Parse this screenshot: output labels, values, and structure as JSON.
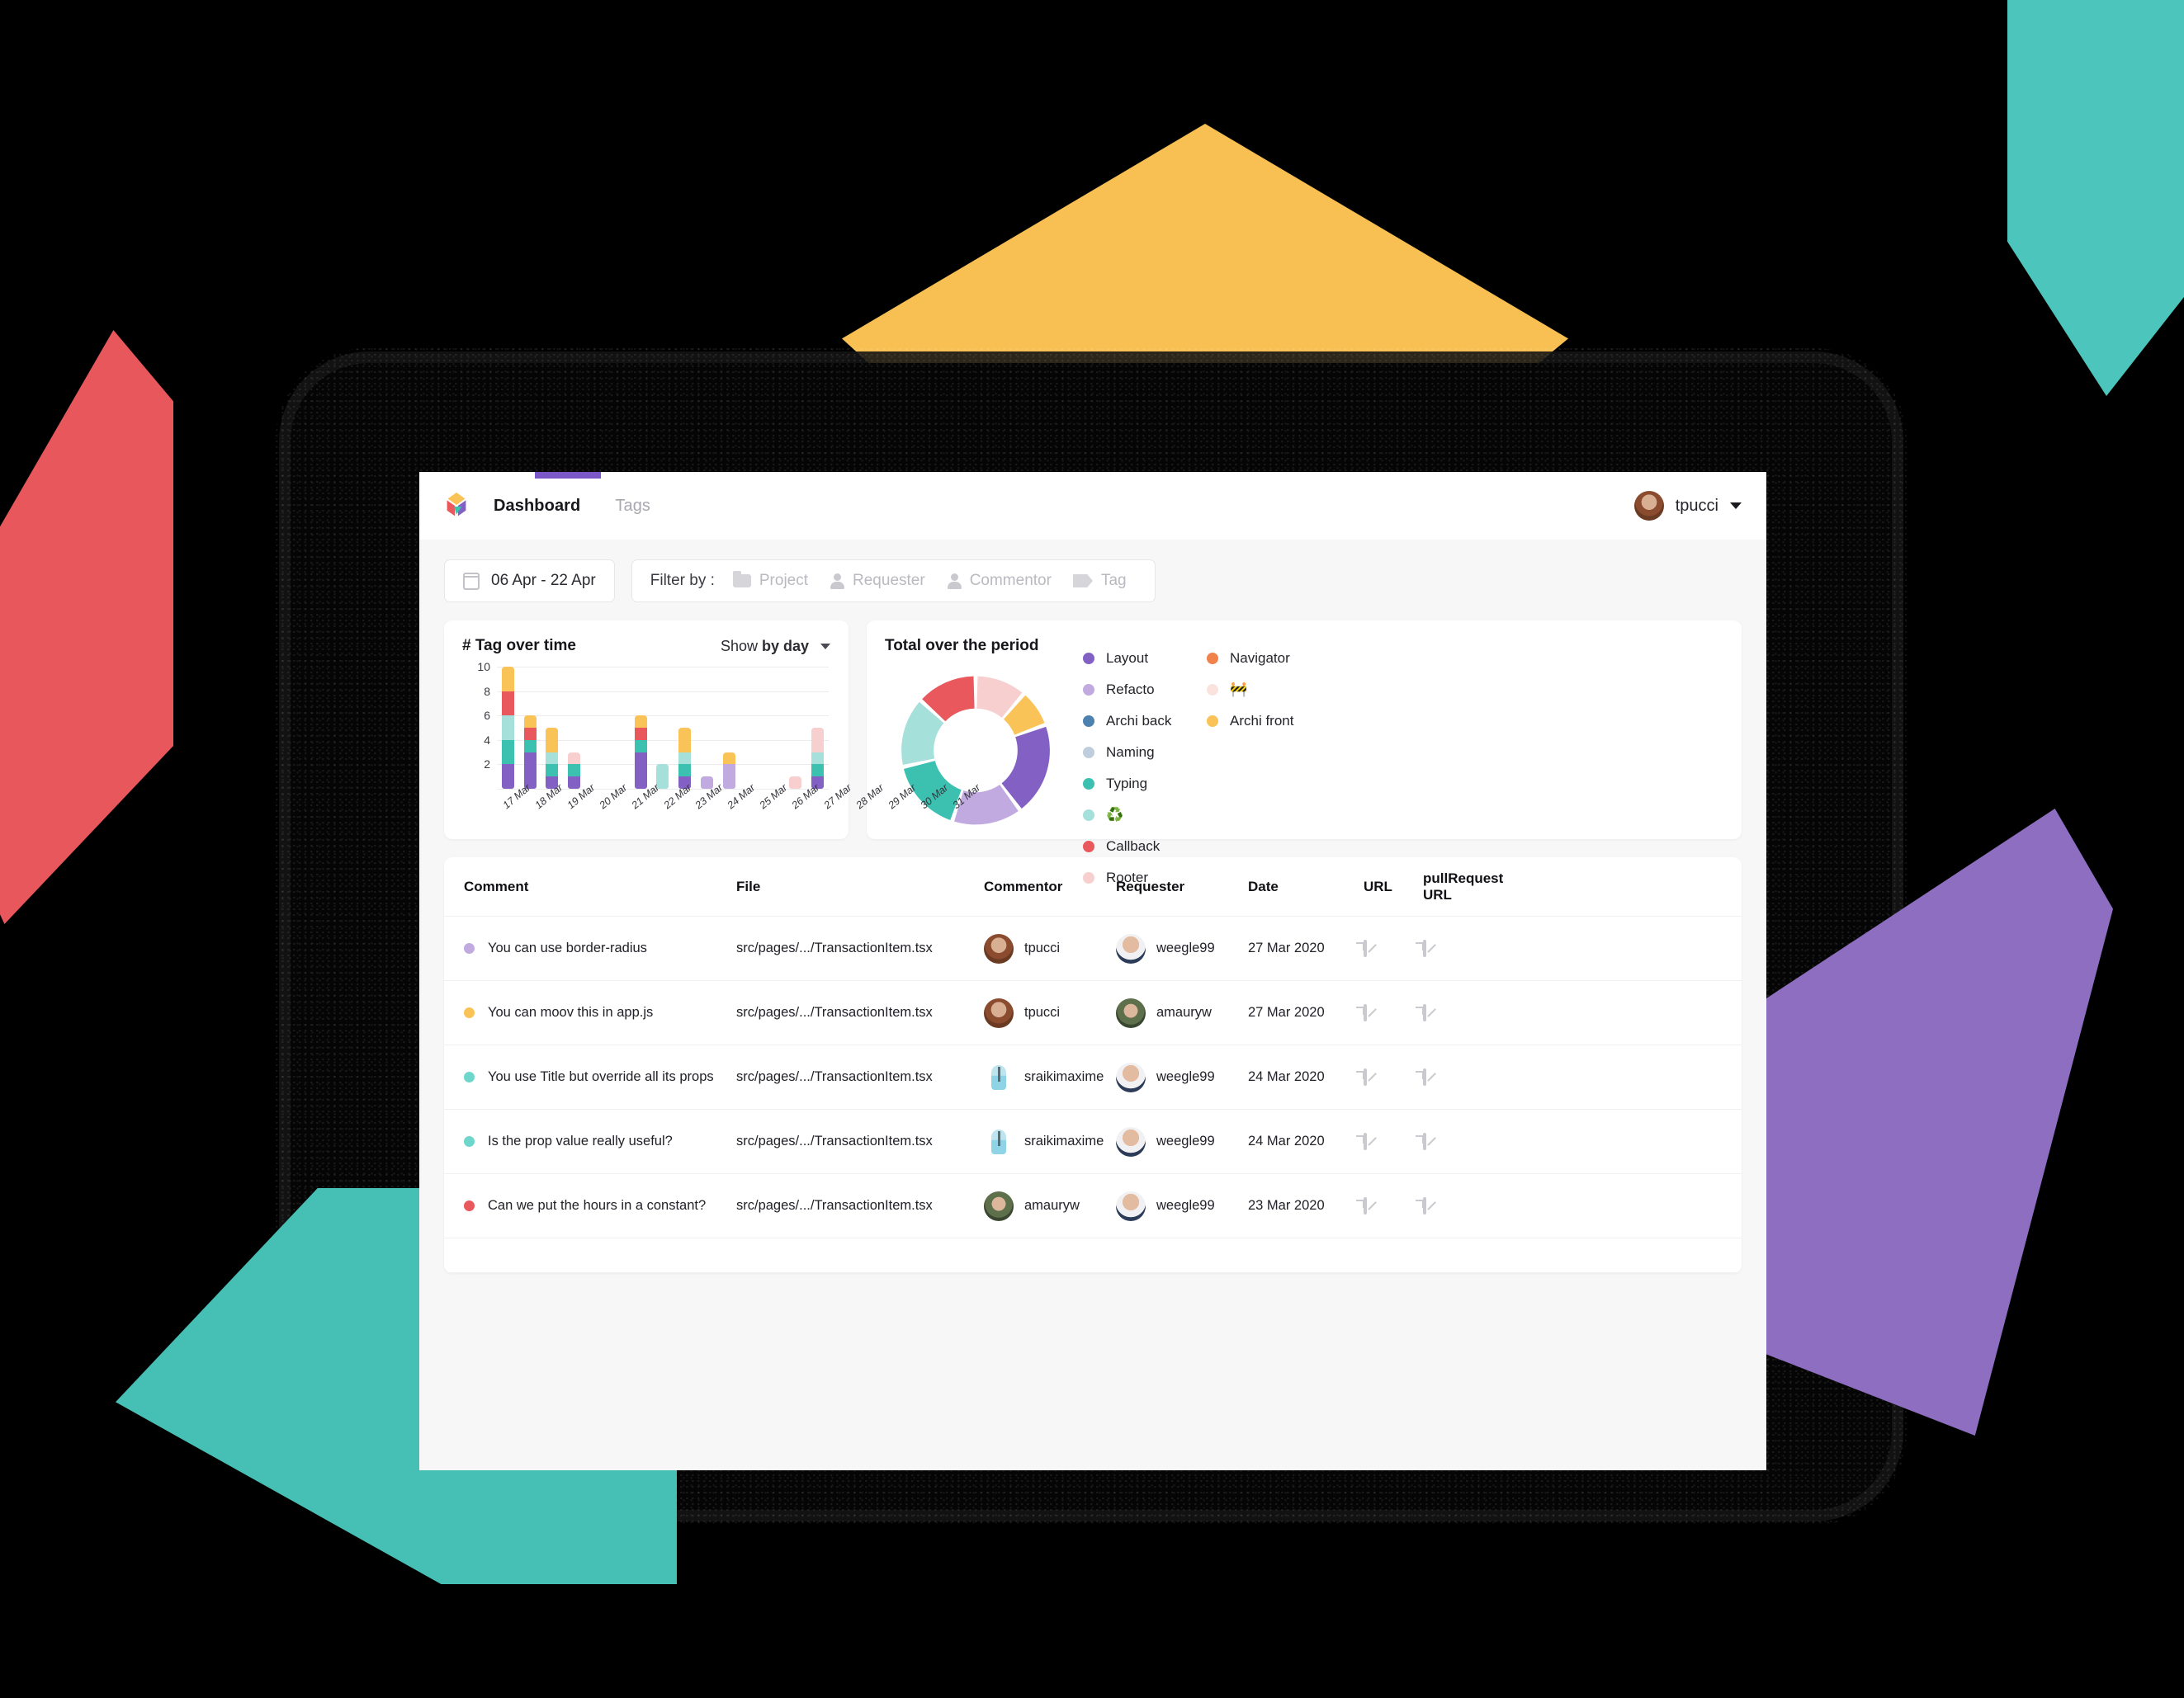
{
  "app": {
    "logo_name": "cube-logo",
    "nav": [
      {
        "label": "Dashboard",
        "active": true
      },
      {
        "label": "Tags",
        "active": false
      }
    ],
    "user": {
      "name": "tpucci",
      "avatar": "avatar-tpucci"
    }
  },
  "filters": {
    "date_range": "06 Apr - 22 Apr",
    "filter_by_label": "Filter by :",
    "chips": [
      {
        "label": "Project",
        "icon": "folder-icon"
      },
      {
        "label": "Requester",
        "icon": "person-icon"
      },
      {
        "label": "Commentor",
        "icon": "person-icon"
      },
      {
        "label": "Tag",
        "icon": "tag-icon"
      }
    ]
  },
  "bar_card": {
    "title": "# Tag over time",
    "show_by_prefix": "Show ",
    "show_by_value": "by day"
  },
  "donut_card": {
    "title": "Total over the period"
  },
  "legend": [
    {
      "label": "Layout",
      "color": "#8360C3"
    },
    {
      "label": "Navigator",
      "color": "#F0824C"
    },
    {
      "label": "Refacto",
      "color": "#C0AADF"
    },
    {
      "label": "🚧",
      "color": "#FBE3DD"
    },
    {
      "label": "Archi back",
      "color": "#4D82B0"
    },
    {
      "label": "Archi front",
      "color": "#F9C357"
    },
    {
      "label": "Naming",
      "color": "#BFCEDC"
    },
    {
      "label": "Typing",
      "color": "#3CC0B0"
    },
    {
      "label": "♻️",
      "color": "#A6E0DB"
    },
    {
      "label": "Callback",
      "color": "#E8585C"
    },
    {
      "label": "Rooter",
      "color": "#F7CFCF"
    }
  ],
  "chart_data": [
    {
      "type": "bar",
      "title": "# Tag over time",
      "stacked": true,
      "xlabel": "",
      "ylabel": "",
      "ylim": [
        0,
        10
      ],
      "yticks": [
        2,
        4,
        6,
        8,
        10
      ],
      "grid": true,
      "legend_position": "none",
      "categories": [
        "17 Mar",
        "18 Mar",
        "19 Mar",
        "20 Mar",
        "21 Mar",
        "22 Mar",
        "23 Mar",
        "24 Mar",
        "25 Mar",
        "26 Mar",
        "27 Mar",
        "28 Mar",
        "29 Mar",
        "30 Mar",
        "31 Mar"
      ],
      "series": [
        {
          "name": "Layout",
          "color": "#8360C3",
          "values": [
            2,
            3,
            1,
            1,
            0,
            0,
            3,
            0,
            1,
            0,
            0,
            0,
            0,
            0,
            1
          ]
        },
        {
          "name": "Refacto",
          "color": "#C0AADF",
          "values": [
            0,
            0,
            0,
            0,
            0,
            0,
            0,
            0,
            0,
            1,
            2,
            0,
            0,
            0,
            0
          ]
        },
        {
          "name": "Typing",
          "color": "#3CC0B0",
          "values": [
            2,
            1,
            1,
            1,
            0,
            0,
            1,
            0,
            1,
            0,
            0,
            0,
            0,
            0,
            1
          ]
        },
        {
          "name": "♻️",
          "color": "#A6E0DB",
          "values": [
            2,
            0,
            1,
            0,
            0,
            0,
            0,
            2,
            1,
            0,
            0,
            0,
            0,
            0,
            1
          ]
        },
        {
          "name": "Callback",
          "color": "#E8585C",
          "values": [
            2,
            1,
            0,
            0,
            0,
            0,
            1,
            0,
            0,
            0,
            0,
            0,
            0,
            0,
            0
          ]
        },
        {
          "name": "Archi front",
          "color": "#F9C357",
          "values": [
            2,
            1,
            2,
            0,
            0,
            0,
            1,
            0,
            2,
            0,
            1,
            0,
            0,
            0,
            0
          ]
        },
        {
          "name": "Rooter",
          "color": "#F7CFCF",
          "values": [
            0,
            0,
            0,
            1,
            0,
            0,
            0,
            0,
            0,
            0,
            0,
            0,
            0,
            1,
            2
          ]
        }
      ],
      "totals": [
        10,
        6,
        5,
        3,
        0,
        0,
        6,
        2,
        5,
        1,
        3,
        0,
        0,
        1,
        5
      ]
    },
    {
      "type": "pie",
      "title": "Total over the period",
      "donut": true,
      "legend_position": "right",
      "labels": [
        "Rooter",
        "Archi front",
        "Layout",
        "Refacto",
        "Typing",
        "♻️",
        "Callback"
      ],
      "colors": [
        "#F7CFCF",
        "#F9C357",
        "#8360C3",
        "#C0AADF",
        "#3CC0B0",
        "#A6E0DB",
        "#E8585C"
      ],
      "values": [
        11,
        8,
        20,
        15,
        16,
        15,
        13
      ],
      "units": "percent"
    }
  ],
  "table": {
    "columns": [
      "Comment",
      "File",
      "Commentor",
      "Requester",
      "Date",
      "URL",
      "pullRequest URL"
    ],
    "rows": [
      {
        "tag_color": "#C0AADF",
        "comment": "You can use border-radius",
        "file": "src/pages/.../TransactionItem.tsx",
        "commentor": "tpucci",
        "commentor_avatar": "av-tpucci",
        "requester": "weegle99",
        "requester_avatar": "av-weegle",
        "date": "27 Mar 2020"
      },
      {
        "tag_color": "#F9C357",
        "comment": "You can moov this in app.js",
        "file": "src/pages/.../TransactionItem.tsx",
        "commentor": "tpucci",
        "commentor_avatar": "av-tpucci",
        "requester": "amauryw",
        "requester_avatar": "av-amaury",
        "date": "27 Mar 2020"
      },
      {
        "tag_color": "#6FD6CC",
        "comment": "You use Title but override all its props",
        "file": "src/pages/.../TransactionItem.tsx",
        "commentor": "sraikimaxime",
        "commentor_avatar": "av-sraiki",
        "requester": "weegle99",
        "requester_avatar": "av-weegle",
        "date": "24 Mar 2020"
      },
      {
        "tag_color": "#6FD6CC",
        "comment": "Is the prop value really useful?",
        "file": "src/pages/.../TransactionItem.tsx",
        "commentor": "sraikimaxime",
        "commentor_avatar": "av-sraiki",
        "requester": "weegle99",
        "requester_avatar": "av-weegle",
        "date": "24 Mar 2020"
      },
      {
        "tag_color": "#E8585C",
        "comment": "Can we put the hours in a constant?",
        "file": "src/pages/.../TransactionItem.tsx",
        "commentor": "amauryw",
        "commentor_avatar": "av-amaury",
        "requester": "weegle99",
        "requester_avatar": "av-weegle",
        "date": "23 Mar 2020"
      }
    ]
  },
  "theme": {
    "accent": "#7B57C8",
    "page_bg": "#F7F7F8",
    "card_bg": "#FFFFFF",
    "backdrop": "#000000",
    "deco_yellow": "#F8C052",
    "deco_teal": "#4CC6BC",
    "deco_red": "#E8575C",
    "deco_purple": "#8E6EC0"
  }
}
